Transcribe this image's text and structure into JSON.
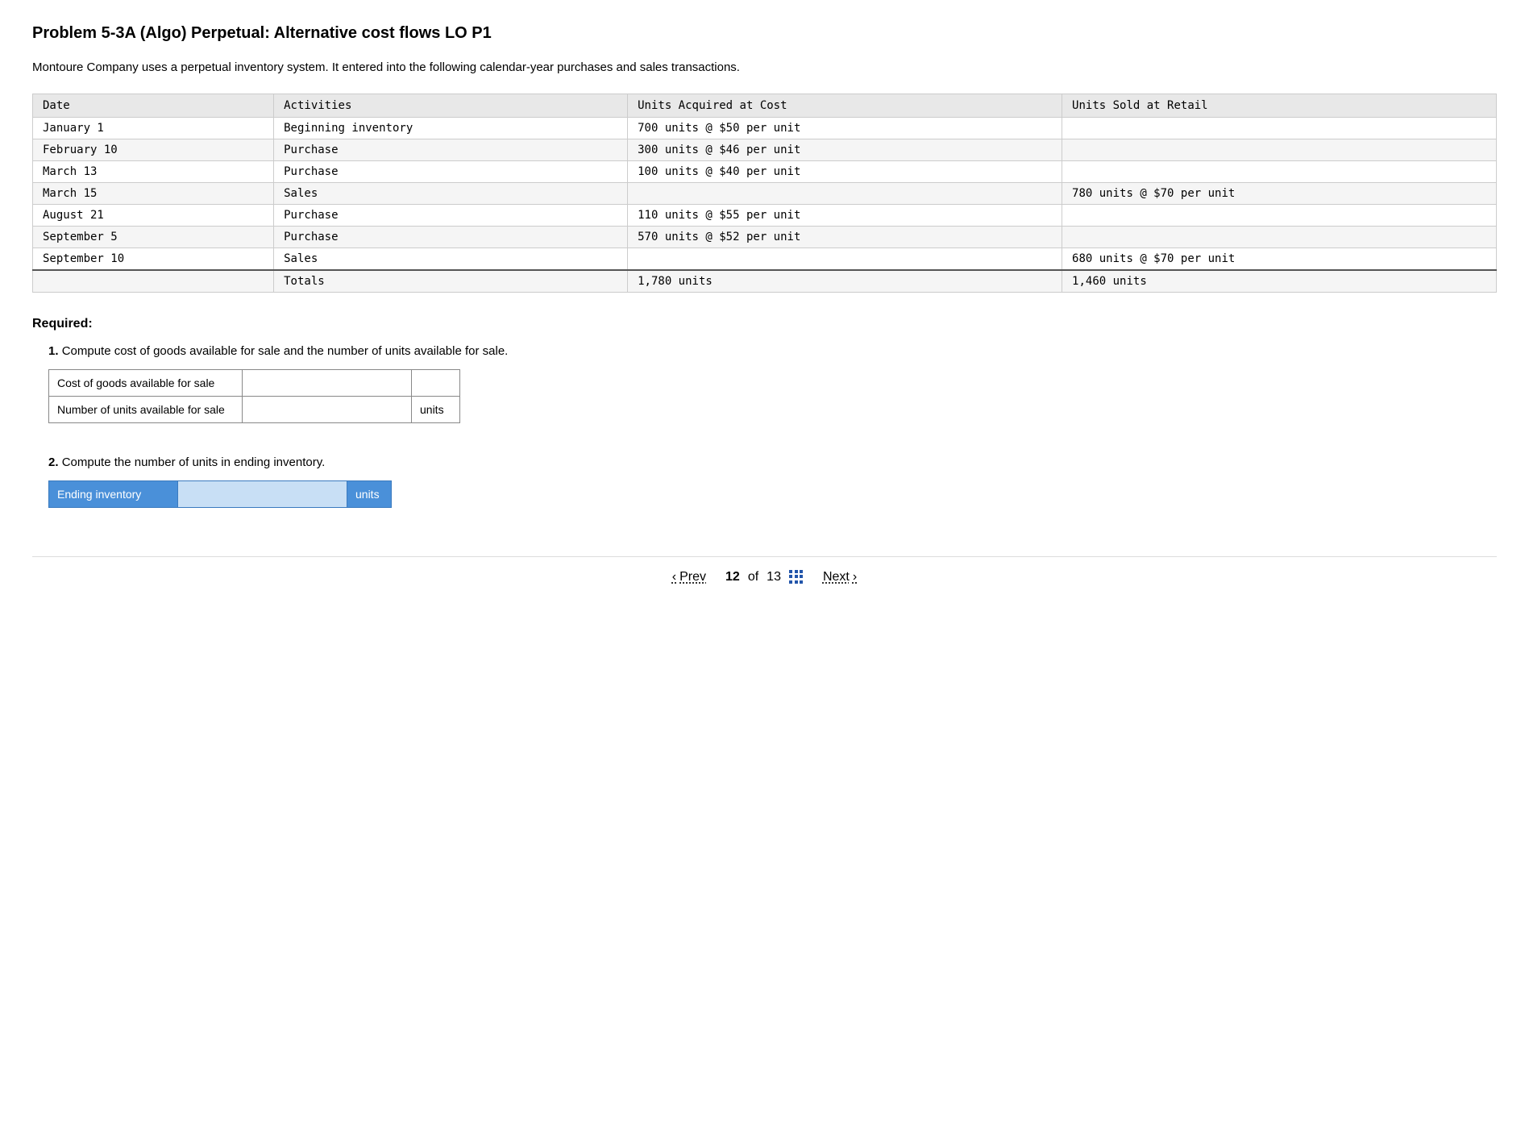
{
  "page": {
    "title": "Problem 5-3A (Algo) Perpetual: Alternative cost flows LO P1",
    "intro": "Montoure Company uses a perpetual inventory system. It entered into the following calendar-year purchases and sales transactions."
  },
  "table": {
    "headers": [
      "Date",
      "Activities",
      "Units Acquired at Cost",
      "Units Sold at Retail"
    ],
    "rows": [
      {
        "date": "January 1",
        "activity": "Beginning inventory",
        "acquired": "700 units  @ $50 per unit",
        "sold": ""
      },
      {
        "date": "February 10",
        "activity": "Purchase",
        "acquired": "300 units  @ $46 per unit",
        "sold": ""
      },
      {
        "date": "March 13",
        "activity": "Purchase",
        "acquired": "100 units  @ $40 per unit",
        "sold": ""
      },
      {
        "date": "March 15",
        "activity": "Sales",
        "acquired": "",
        "sold": "780 units @ $70 per unit"
      },
      {
        "date": "August 21",
        "activity": "Purchase",
        "acquired": "110 units  @ $55 per unit",
        "sold": ""
      },
      {
        "date": "September 5",
        "activity": "Purchase",
        "acquired": "570 units  @ $52 per unit",
        "sold": ""
      },
      {
        "date": "September 10",
        "activity": "Sales",
        "acquired": "",
        "sold": "680 units @ $70 per unit"
      }
    ],
    "totals": {
      "label": "Totals",
      "acquired": "1,780 units",
      "sold": "1,460 units"
    }
  },
  "required": {
    "label": "Required:"
  },
  "question1": {
    "number": "1.",
    "text": "Compute cost of goods available for sale and the number of units available for sale.",
    "rows": [
      {
        "label": "Cost of goods available for sale",
        "input_value": "",
        "units": ""
      },
      {
        "label": "Number of units available for sale",
        "input_value": "",
        "units": "units"
      }
    ]
  },
  "question2": {
    "number": "2.",
    "text": "Compute the number of units in ending inventory.",
    "label": "Ending inventory",
    "input_value": "",
    "units": "units"
  },
  "nav": {
    "prev_label": "Prev",
    "next_label": "Next",
    "current_page": "12",
    "total_pages": "13",
    "of_text": "of"
  }
}
